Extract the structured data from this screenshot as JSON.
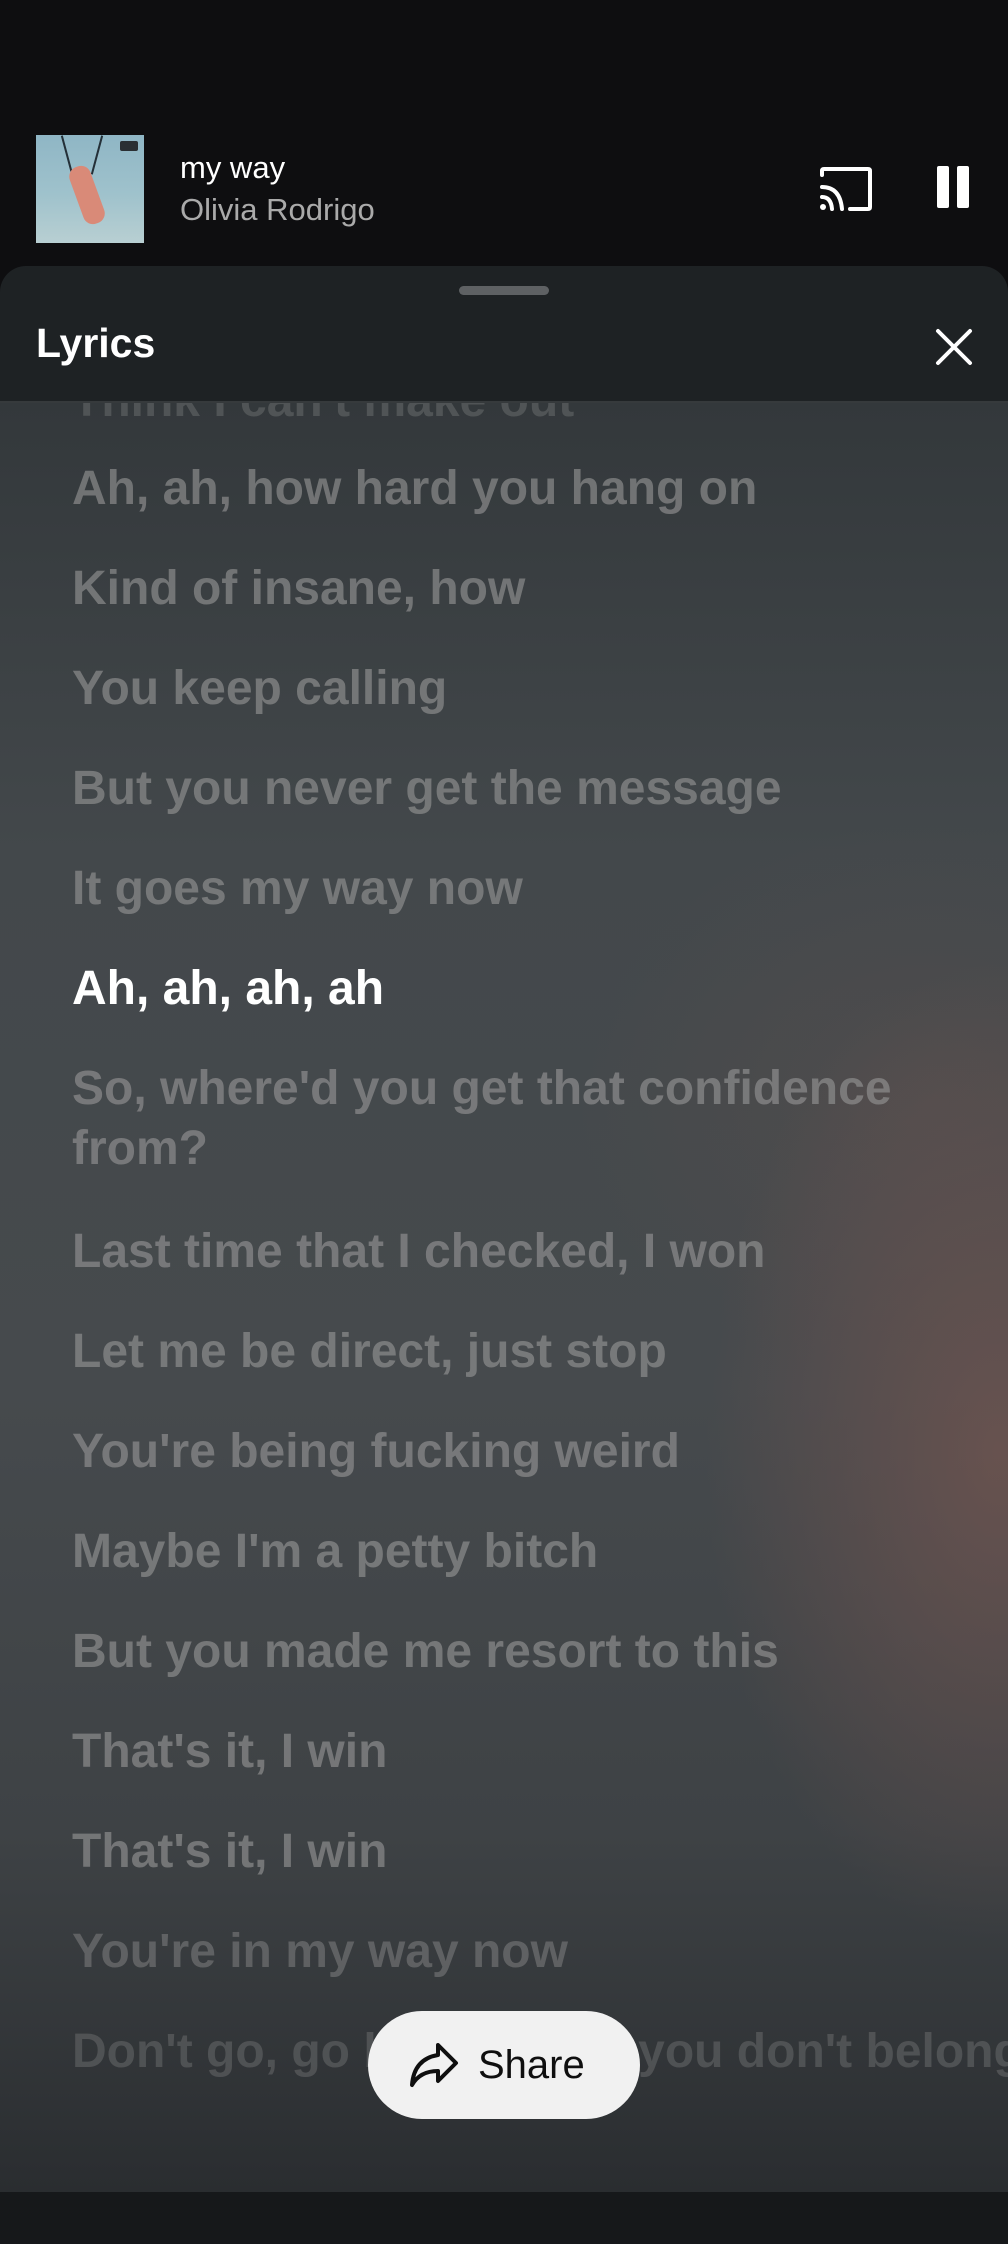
{
  "now_playing": {
    "title": "my way",
    "artist": "Olivia Rodrigo",
    "cast_icon": "cast-icon",
    "pause_icon": "pause-icon"
  },
  "sheet": {
    "title": "Lyrics",
    "close_icon": "close-icon"
  },
  "lyrics": {
    "lines": [
      "Think I can't make out",
      "Ah, ah, how hard you hang on",
      "Kind of insane, how",
      "You keep calling",
      "But you never get the message",
      "It goes my way now",
      "Ah, ah, ah, ah",
      "So, where'd you get that confidence from?",
      "Last time that I checked, I won",
      "Let me be direct, just stop",
      "You're being fucking weird",
      "Maybe I'm a petty bitch",
      "But you made me resort to this",
      "That's it, I win",
      "That's it, I win",
      "You're in my way now",
      "Don't go, go back where you don't belong"
    ],
    "active_index": 6
  },
  "share": {
    "label": "Share",
    "icon": "share-icon"
  },
  "colors": {
    "background": "#0e0e10",
    "sheet": "#1e2224",
    "active_lyric": "#ffffff",
    "inactive_lyric": "#969696"
  }
}
